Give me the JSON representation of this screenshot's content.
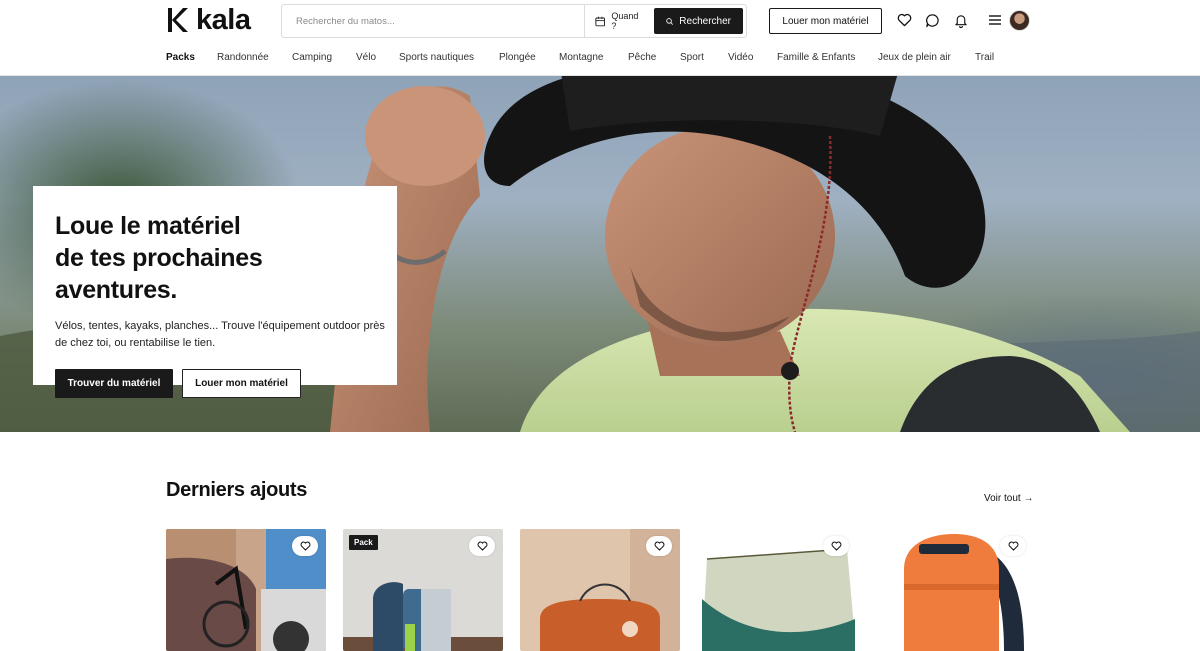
{
  "brand": {
    "name": "kala"
  },
  "search": {
    "placeholder": "Rechercher du matos...",
    "when_label": "Quand ?",
    "button_label": "Rechercher"
  },
  "header": {
    "rent_button": "Louer mon matériel"
  },
  "icons": [
    "heart-icon",
    "chat-icon",
    "bell-icon",
    "menu-icon",
    "avatar"
  ],
  "nav": {
    "items": [
      "Packs",
      "Randonnée",
      "Camping",
      "Vélo",
      "Sports nautiques",
      "Plongée",
      "Montagne",
      "Pêche",
      "Sport",
      "Vidéo",
      "Famille & Enfants",
      "Jeux de plein air",
      "Trail"
    ],
    "active": "Packs"
  },
  "hero": {
    "title_line1": "Loue le matériel",
    "title_line2": "de tes prochaines aventures.",
    "subtitle": "Vélos, tentes, kayaks, planches... Trouve l'équipement outdoor près de chez toi, ou rentabilise le tien.",
    "primary_button": "Trouver du matériel",
    "secondary_button": "Louer mon matériel"
  },
  "latest": {
    "title": "Derniers ajouts",
    "see_all": "Voir tout →",
    "items": [
      {
        "image": "bike-rack-car",
        "badge": ""
      },
      {
        "image": "camping-pack",
        "badge": "Pack"
      },
      {
        "image": "orange-hammock-bag",
        "badge": ""
      },
      {
        "image": "green-hammock-mosquito-net",
        "badge": ""
      },
      {
        "image": "orange-mammut-backpack",
        "badge": ""
      }
    ]
  },
  "colors": {
    "primary": "#1a1a1a",
    "background": "#ffffff",
    "border": "#dcdcdc"
  }
}
